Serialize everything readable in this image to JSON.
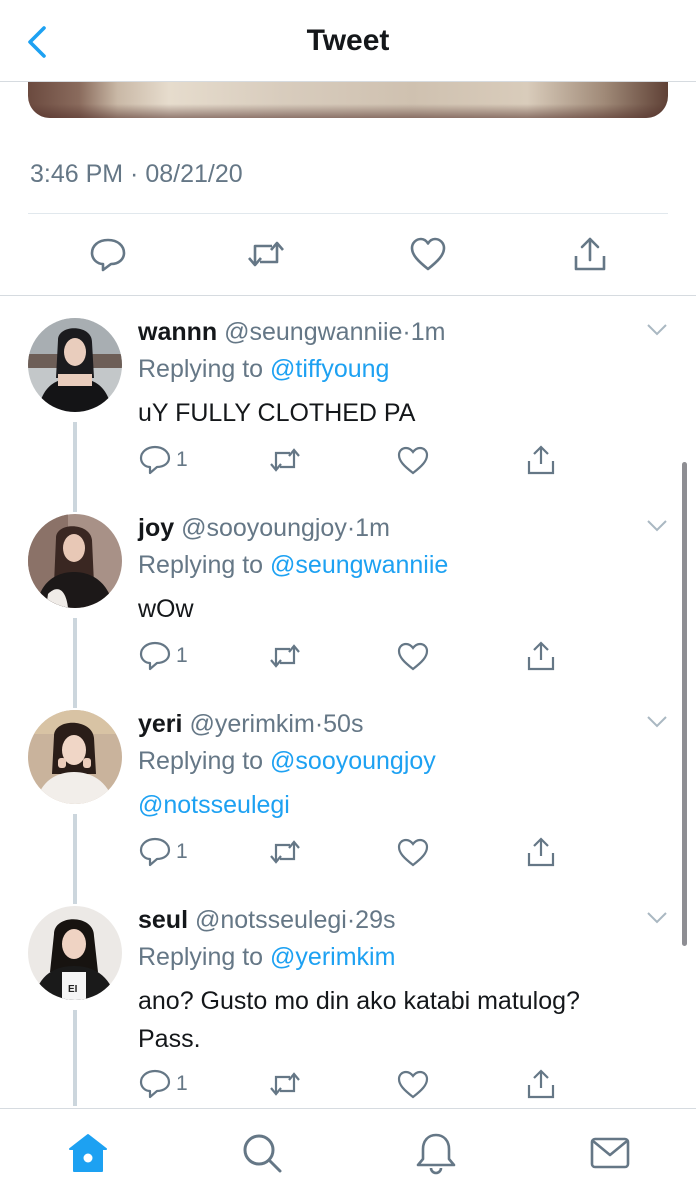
{
  "header": {
    "title": "Tweet",
    "back_icon": "chevron-left-icon"
  },
  "tweet": {
    "timestamp": "3:46 PM · 08/21/20"
  },
  "main_actions": [
    "reply-icon",
    "retweet-icon",
    "like-icon",
    "share-icon"
  ],
  "replies": [
    {
      "name": "wannn",
      "handle": "@seungwanniie",
      "dot": "·",
      "time": "1m",
      "replying_prefix": "Replying to ",
      "replying_to": "@tiffyoung",
      "text": "uY FULLY CLOTHED PA",
      "reply_count": "1"
    },
    {
      "name": "joy",
      "handle": "@sooyoungjoy",
      "dot": "·",
      "time": "1m",
      "replying_prefix": "Replying to ",
      "replying_to": "@seungwanniie",
      "text": "wOw",
      "reply_count": "1"
    },
    {
      "name": "yeri",
      "handle": "@yerimkim",
      "dot": "·",
      "time": "50s",
      "replying_prefix": "Replying to ",
      "replying_to": "@sooyoungjoy",
      "text": "@notsseulegi",
      "reply_count": "1"
    },
    {
      "name": "seul",
      "handle": "@notsseulegi",
      "dot": "·",
      "time": "29s",
      "replying_prefix": "Replying to ",
      "replying_to": "@yerimkim",
      "text_line1": "ano? Gusto mo din ako katabi matulog?",
      "text_line2": "Pass.",
      "reply_count": "1"
    }
  ],
  "tabbar": [
    "home-icon",
    "search-icon",
    "notifications-icon",
    "messages-icon"
  ],
  "colors": {
    "accent": "#1da1f2",
    "secondary_text": "#657786",
    "primary_text": "#14171a",
    "divider": "#e1e8ed"
  }
}
